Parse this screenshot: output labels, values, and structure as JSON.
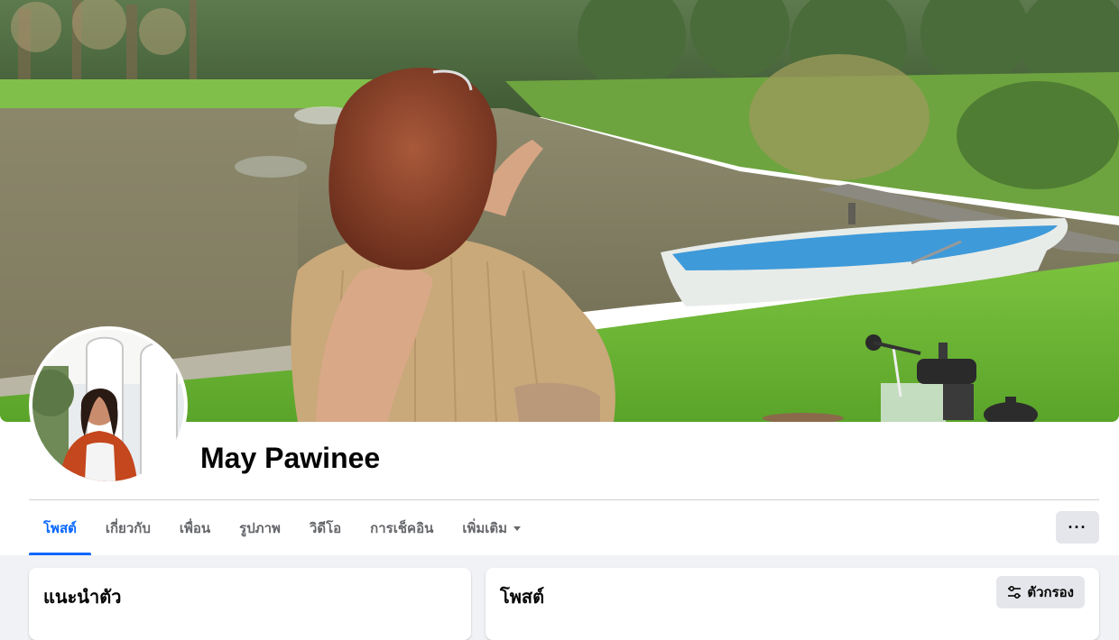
{
  "profile": {
    "name": "May Pawinee"
  },
  "tabs": [
    {
      "label": "โพสต์",
      "active": true
    },
    {
      "label": "เกี่ยวกับ",
      "active": false
    },
    {
      "label": "เพื่อน",
      "active": false
    },
    {
      "label": "รูปภาพ",
      "active": false
    },
    {
      "label": "วิดีโอ",
      "active": false
    },
    {
      "label": "การเช็คอิน",
      "active": false
    },
    {
      "label": "เพิ่มเติม",
      "active": false
    }
  ],
  "actions": {
    "more_label": "···"
  },
  "intro": {
    "title": "แนะนำตัว"
  },
  "posts": {
    "title": "โพสต์",
    "filter_label": "ตัวกรอง"
  },
  "colors": {
    "accent": "#0866ff",
    "page_background": "#f0f2f5",
    "button_background": "#e4e6eb"
  }
}
